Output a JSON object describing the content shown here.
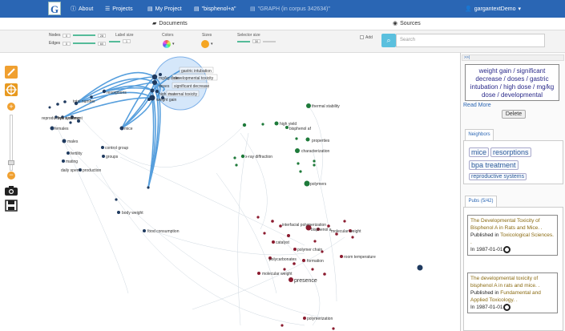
{
  "header": {
    "logo": "G",
    "nav": [
      {
        "icon": "info-icon",
        "label": "About"
      },
      {
        "icon": "tasks-icon",
        "label": "Projects"
      },
      {
        "icon": "file-icon",
        "label": "My Project"
      },
      {
        "icon": "file-icon",
        "label": "\"bisphenol+a\""
      },
      {
        "icon": "file-icon",
        "label": "\"GRAPH (in corpus 342634)\""
      }
    ],
    "user": "gargantextDemo"
  },
  "tabs": {
    "documents": "Documents",
    "sources": "Sources"
  },
  "controls": {
    "nodes_label": "Nodes",
    "nodes_min": "0",
    "nodes_max": "28",
    "edges_label": "Edges",
    "edges_min": "0",
    "edges_max": "60",
    "label_size_label": "Label size",
    "label_size_value": "1",
    "colors_label": "Colors",
    "sizes_label": "Sizes",
    "selector_size_label": "Selector size",
    "selector_size_value": "30",
    "add_label": "Add",
    "search_placeholder": "Search"
  },
  "sidepanel": {
    "header_icon": ">>|",
    "selection_text": "weight gain / significant decrease / doses / gastric intubation / high dose / mg/kg dose / developmental",
    "read_more": "Read More",
    "delete": "Delete",
    "neighbors_tab": "Neighbors",
    "neighbors": [
      "mice",
      "resorptions",
      "bpa treatment",
      "reproductive systems"
    ],
    "pubs_tab": "Pubs (5/42)",
    "pubs": [
      {
        "title": "The Developmental Toxicity of Bisphenol A in Rats and Mice. .",
        "published_in": "Published in",
        "source": "Toxicological Sciences. .",
        "date_prefix": "In",
        "date": "1987-01-01"
      },
      {
        "title": "The developmental toxicity of bisphenol A in rats and mice. .",
        "published_in": "Published in",
        "source": "Fundamental and Applied Toxicology. .",
        "date_prefix": "In",
        "date": "1987-01-01"
      }
    ]
  },
  "graph": {
    "colors": {
      "blue": "#1f3a5f",
      "green": "#1e7a3a",
      "red": "#8b1a2e",
      "edge": "#3a8fd8"
    },
    "clusters": {
      "blue": {
        "nodes": [
          {
            "label": "gastric intubation"
          },
          {
            "label": "developmental toxicity"
          },
          {
            "label": "mg/kg dose"
          },
          {
            "label": "significant decrease"
          },
          {
            "label": "doses"
          },
          {
            "label": "high dose"
          },
          {
            "label": "weight gain"
          },
          {
            "label": "maternal toxicity"
          },
          {
            "label": "resorptions"
          },
          {
            "label": "reproductive systems"
          },
          {
            "label": "bpa treatment"
          },
          {
            "label": "total number"
          },
          {
            "label": "mice"
          },
          {
            "label": "females"
          },
          {
            "label": "fertility"
          },
          {
            "label": "males"
          },
          {
            "label": "control group"
          },
          {
            "label": "groups"
          },
          {
            "label": "mating"
          },
          {
            "label": "daily sperm production"
          },
          {
            "label": "body weight"
          },
          {
            "label": "food consumption"
          }
        ]
      },
      "green": {
        "nodes": [
          {
            "label": "thermal stability"
          },
          {
            "label": "high yield"
          },
          {
            "label": "bisphenol af"
          },
          {
            "label": "properties"
          },
          {
            "label": "characterization"
          },
          {
            "label": "x-ray diffraction"
          },
          {
            "label": "polymers"
          }
        ]
      },
      "red": {
        "nodes": [
          {
            "label": "interfacial polymerization"
          },
          {
            "label": "catalyst"
          },
          {
            "label": "molecular weight"
          },
          {
            "label": "polymer chain"
          },
          {
            "label": "polycarbonates"
          },
          {
            "label": "formation"
          },
          {
            "label": "bisphenol a"
          },
          {
            "label": "molecular weight"
          },
          {
            "label": "room temperature"
          },
          {
            "label": "presence"
          },
          {
            "label": "polymerization"
          }
        ]
      }
    }
  }
}
